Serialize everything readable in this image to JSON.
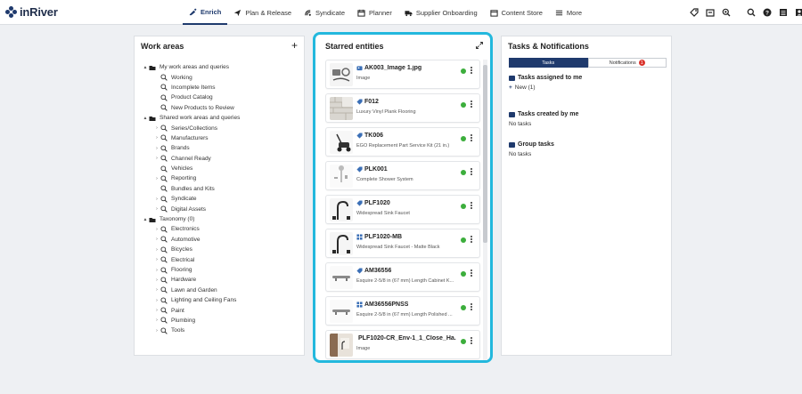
{
  "app": {
    "logo_text": "inRiver",
    "brand_color": "#1f3a6d"
  },
  "nav": [
    {
      "label": "Enrich",
      "icon": "enrich-icon",
      "active": true
    },
    {
      "label": "Plan & Release",
      "icon": "plane-icon"
    },
    {
      "label": "Syndicate",
      "icon": "syndicate-icon"
    },
    {
      "label": "Planner",
      "icon": "calendar-icon"
    },
    {
      "label": "Supplier Onboarding",
      "icon": "truck-icon"
    },
    {
      "label": "Content Store",
      "icon": "store-icon"
    },
    {
      "label": "More",
      "icon": "hamburger-icon"
    }
  ],
  "tools_left": [
    "tag-icon",
    "archive-icon",
    "zoom-icon"
  ],
  "tools_right": [
    "search-icon",
    "help-icon",
    "grid-icon",
    "user-icon"
  ],
  "work_areas": {
    "title": "Work areas",
    "add_label": "+",
    "tree": [
      {
        "label": "My work areas and queries",
        "level": 0,
        "toggle": "▲",
        "icon": "folder"
      },
      {
        "label": "Working",
        "level": 1,
        "toggle": "",
        "icon": "query"
      },
      {
        "label": "Incomplete Items",
        "level": 1,
        "toggle": "",
        "icon": "query"
      },
      {
        "label": "Product Catalog",
        "level": 1,
        "toggle": "",
        "icon": "query"
      },
      {
        "label": "New Products to Review",
        "level": 1,
        "toggle": "",
        "icon": "query"
      },
      {
        "label": "Shared work areas and queries",
        "level": 0,
        "toggle": "▲",
        "icon": "folder"
      },
      {
        "label": "Series/Collections",
        "level": 1,
        "toggle": "›",
        "icon": "query"
      },
      {
        "label": "Manufacturers",
        "level": 1,
        "toggle": "›",
        "icon": "query"
      },
      {
        "label": "Brands",
        "level": 1,
        "toggle": "›",
        "icon": "query"
      },
      {
        "label": "Channel Ready",
        "level": 1,
        "toggle": "›",
        "icon": "query"
      },
      {
        "label": "Vehicles",
        "level": 1,
        "toggle": "",
        "icon": "query"
      },
      {
        "label": "Reporting",
        "level": 1,
        "toggle": "›",
        "icon": "query"
      },
      {
        "label": "Bundles and Kits",
        "level": 1,
        "toggle": "",
        "icon": "query"
      },
      {
        "label": "Syndicate",
        "level": 1,
        "toggle": "›",
        "icon": "query"
      },
      {
        "label": "Digital Assets",
        "level": 1,
        "toggle": "›",
        "icon": "query"
      },
      {
        "label": "Taxonomy (0)",
        "level": 0,
        "toggle": "▲",
        "icon": "folder"
      },
      {
        "label": "Electronics",
        "level": 1,
        "toggle": "›",
        "icon": "query"
      },
      {
        "label": "Automotive",
        "level": 1,
        "toggle": "›",
        "icon": "query"
      },
      {
        "label": "Bicycles",
        "level": 1,
        "toggle": "›",
        "icon": "query"
      },
      {
        "label": "Electrical",
        "level": 1,
        "toggle": "›",
        "icon": "query"
      },
      {
        "label": "Flooring",
        "level": 1,
        "toggle": "›",
        "icon": "query"
      },
      {
        "label": "Hardware",
        "level": 1,
        "toggle": "›",
        "icon": "query"
      },
      {
        "label": "Lawn and Garden",
        "level": 1,
        "toggle": "›",
        "icon": "query"
      },
      {
        "label": "Lighting and Ceiling Fans",
        "level": 1,
        "toggle": "›",
        "icon": "query"
      },
      {
        "label": "Paint",
        "level": 1,
        "toggle": "›",
        "icon": "query"
      },
      {
        "label": "Plumbing",
        "level": 1,
        "toggle": "›",
        "icon": "query"
      },
      {
        "label": "Tools",
        "level": 1,
        "toggle": "›",
        "icon": "query"
      }
    ]
  },
  "starred": {
    "title": "Starred entities",
    "status_color": "#3cae3c",
    "items": [
      {
        "title": "AK003_Image 1.jpg",
        "subtitle": "Image",
        "type_icon": "image-type-icon",
        "thumb": "kit"
      },
      {
        "title": "F012",
        "subtitle": "Luxury Vinyl Plank Flooring",
        "type_icon": "tag-type-icon",
        "thumb": "floor"
      },
      {
        "title": "TK006",
        "subtitle": "EGO Replacement Part Service Kit (21 in.)",
        "type_icon": "tag-type-icon",
        "thumb": "mower"
      },
      {
        "title": "PLK001",
        "subtitle": "Complete Shower System",
        "type_icon": "tag-type-icon",
        "thumb": "shower"
      },
      {
        "title": "PLF1020",
        "subtitle": "Widespread Sink Faucet",
        "type_icon": "tag-type-icon",
        "thumb": "faucet"
      },
      {
        "title": "PLF1020-MB",
        "subtitle": "Widespread Sink Faucet - Matte Black",
        "type_icon": "grid-type-icon",
        "thumb": "faucet"
      },
      {
        "title": "AM36556",
        "subtitle": "Esquire 2-5/8 in (67 mm) Length Cabinet K...",
        "type_icon": "tag-type-icon",
        "thumb": "handle"
      },
      {
        "title": "AM36556PNSS",
        "subtitle": "Esquire 2-5/8 in (67 mm) Length Polished ...",
        "type_icon": "grid-type-icon",
        "thumb": "handle"
      },
      {
        "title": "PLF1020-CR_Env-1_1_Close_Ha...",
        "subtitle": "Image",
        "type_icon": "image-type-icon",
        "thumb": "room"
      }
    ]
  },
  "tasks": {
    "title": "Tasks & Notifications",
    "tab_tasks": "Tasks",
    "tab_notifications": "Notifications",
    "notification_count": "1",
    "assigned_title": "Tasks assigned to me",
    "assigned_new": "New (1)",
    "created_title": "Tasks created by me",
    "created_body": "No tasks",
    "group_title": "Group tasks",
    "group_body": "No tasks"
  }
}
